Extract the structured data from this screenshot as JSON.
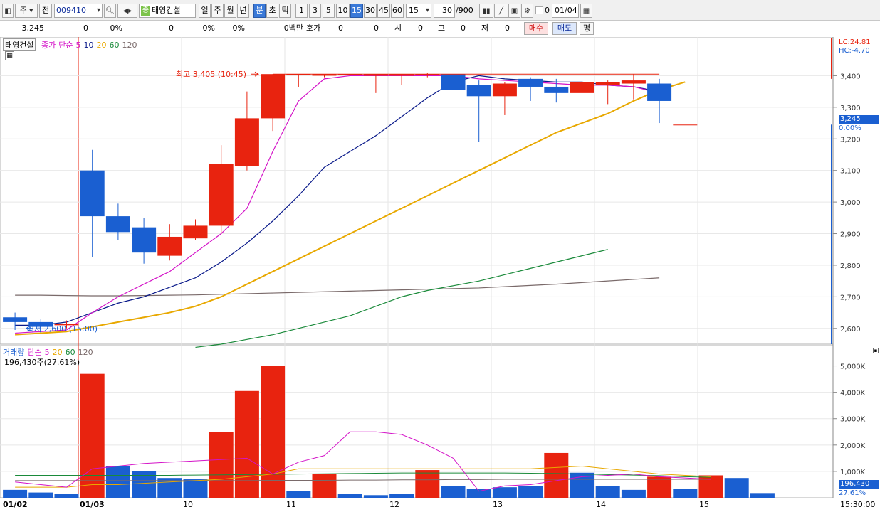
{
  "toolbar": {
    "period_daily": "주",
    "prev": "전",
    "code": "009410",
    "stock_name": "태영건설",
    "stock_badge": "종",
    "periods": [
      "일",
      "주",
      "월",
      "년",
      "분",
      "초",
      "틱"
    ],
    "selected_period": "분",
    "intervals": [
      "1",
      "3",
      "5",
      "10",
      "15",
      "30",
      "45",
      "60"
    ],
    "selected_interval": "15",
    "interval_value": "15",
    "count": "30",
    "count_total": "/900",
    "checkbox_value": "0",
    "date": "01/04"
  },
  "info": {
    "price": "3,245",
    "change": "0",
    "change_pct": "0%",
    "volume": "0",
    "volume_pct": "0%",
    "val_pct": "0%",
    "amount": "0백만",
    "hoga_label": "호가",
    "hoga_value": "0",
    "hoga_value2": "0",
    "open_label": "시",
    "open_value": "0",
    "high_label": "고",
    "high_value": "0",
    "low_label": "저",
    "low_value": "0",
    "buy_button": "매수",
    "sell_button": "매도",
    "eval_button": "평"
  },
  "colors": {
    "up": "#e8230f",
    "down": "#1a5fd1",
    "ma5": "#d414c8",
    "ma10": "#0a1a8a",
    "ma20": "#e8a800",
    "ma60": "#1a8a3a",
    "ma120": "#7a6a6a"
  },
  "chart_data": [
    {
      "type": "candlestick",
      "title": "태영건설",
      "legend": [
        "종가",
        "단순",
        "5",
        "10",
        "20",
        "60",
        "120"
      ],
      "ylim": [
        2550,
        3500
      ],
      "yticks": [
        2600,
        2700,
        2800,
        2900,
        3000,
        3100,
        3200,
        3300,
        3400
      ],
      "ytick_labels": [
        "2,600",
        "2,700",
        "2,800",
        "2,900",
        "3,000",
        "3,100",
        "3,200",
        "3,300",
        "3,400"
      ],
      "candles": [
        {
          "o": 2635,
          "h": 2650,
          "l": 2595,
          "c": 2620
        },
        {
          "o": 2620,
          "h": 2630,
          "l": 2600,
          "c": 2605
        },
        {
          "o": 2610,
          "h": 2625,
          "l": 2600,
          "c": 2615
        },
        {
          "o": 3100,
          "h": 3165,
          "l": 2825,
          "c": 2955
        },
        {
          "o": 2955,
          "h": 2995,
          "l": 2880,
          "c": 2905
        },
        {
          "o": 2920,
          "h": 2950,
          "l": 2805,
          "c": 2840
        },
        {
          "o": 2830,
          "h": 2930,
          "l": 2815,
          "c": 2890
        },
        {
          "o": 2885,
          "h": 2945,
          "l": 2880,
          "c": 2925
        },
        {
          "o": 2925,
          "h": 3180,
          "l": 2900,
          "c": 3120
        },
        {
          "o": 3115,
          "h": 3350,
          "l": 3100,
          "c": 3265
        },
        {
          "o": 3265,
          "h": 3405,
          "l": 3225,
          "c": 3405
        },
        {
          "o": 3405,
          "h": 3405,
          "l": 3365,
          "c": 3405
        },
        {
          "o": 3400,
          "h": 3405,
          "l": 3395,
          "c": 3405
        },
        {
          "o": 3405,
          "h": 3405,
          "l": 3400,
          "c": 3405
        },
        {
          "o": 3400,
          "h": 3405,
          "l": 3345,
          "c": 3405
        },
        {
          "o": 3400,
          "h": 3405,
          "l": 3370,
          "c": 3405
        },
        {
          "o": 3405,
          "h": 3410,
          "l": 3395,
          "c": 3405
        },
        {
          "o": 3405,
          "h": 3405,
          "l": 3380,
          "c": 3355
        },
        {
          "o": 3370,
          "h": 3385,
          "l": 3190,
          "c": 3335
        },
        {
          "o": 3335,
          "h": 3380,
          "l": 3275,
          "c": 3375
        },
        {
          "o": 3390,
          "h": 3395,
          "l": 3320,
          "c": 3365
        },
        {
          "o": 3365,
          "h": 3390,
          "l": 3315,
          "c": 3345
        },
        {
          "o": 3345,
          "h": 3385,
          "l": 3255,
          "c": 3380
        },
        {
          "o": 3370,
          "h": 3385,
          "l": 3310,
          "c": 3380
        },
        {
          "o": 3375,
          "h": 3405,
          "l": 3325,
          "c": 3385
        },
        {
          "o": 3375,
          "h": 3390,
          "l": 3250,
          "c": 3320
        },
        {
          "o": 3245,
          "h": 3245,
          "l": 3245,
          "c": 3245
        }
      ],
      "ma5": [
        2585,
        2590,
        2595,
        2650,
        2700,
        2740,
        2780,
        2840,
        2900,
        2980,
        3160,
        3320,
        3390,
        3400,
        3400,
        3400,
        3400,
        3400,
        3390,
        3385,
        3380,
        3375,
        3370,
        3370,
        3365,
        3345
      ],
      "ma10": [
        2610,
        2610,
        2620,
        2650,
        2680,
        2700,
        2730,
        2760,
        2810,
        2870,
        2940,
        3020,
        3110,
        3160,
        3210,
        3270,
        3330,
        3380,
        3400,
        3390,
        3385,
        3380,
        3380,
        3370,
        3365,
        3350
      ],
      "ma20": [
        2580,
        2585,
        2590,
        2605,
        2620,
        2635,
        2650,
        2670,
        2700,
        2740,
        2780,
        2820,
        2860,
        2900,
        2940,
        2980,
        3020,
        3060,
        3100,
        3140,
        3180,
        3220,
        3250,
        3280,
        3320,
        3355,
        3380
      ],
      "ma60": [
        null,
        null,
        null,
        null,
        null,
        null,
        null,
        2540,
        2550,
        2565,
        2580,
        2600,
        2620,
        2640,
        2670,
        2700,
        2720,
        2735,
        2750,
        2770,
        2790,
        2810,
        2830,
        2850
      ],
      "ma120": [
        2705,
        2705,
        2704,
        2703,
        2703,
        2704,
        2705,
        2706,
        2708,
        2710,
        2712,
        2714,
        2716,
        2718,
        2720,
        2722,
        2724,
        2726,
        2728,
        2732,
        2736,
        2740,
        2745,
        2750,
        2755,
        2760
      ],
      "high_annotation": "최고 3,405 (10:45)",
      "low_annotation": "최저 2,600 (15:00)",
      "current_price": "3,245",
      "current_pct": "0.00%",
      "lc_label": "LC:24.81",
      "hc_label": "HC:-4.70"
    },
    {
      "type": "bar",
      "title": "거래량",
      "legend": [
        "거래량",
        "단순",
        "5",
        "20",
        "60",
        "120"
      ],
      "current_label": "196,430주(27.61%)",
      "ylim": [
        0,
        5500
      ],
      "yticks": [
        1000,
        2000,
        3000,
        4000,
        5000
      ],
      "ytick_labels": [
        "1,000K",
        "2,000K",
        "3,000K",
        "4,000K",
        "5,000K"
      ],
      "values": [
        300,
        200,
        150,
        4700,
        1200,
        1000,
        750,
        700,
        2500,
        4050,
        5000,
        250,
        900,
        150,
        100,
        150,
        1050,
        450,
        350,
        400,
        450,
        1700,
        950,
        450,
        300,
        800,
        350,
        850,
        750,
        180
      ],
      "up": [
        false,
        false,
        false,
        true,
        false,
        false,
        false,
        false,
        true,
        true,
        true,
        false,
        true,
        false,
        false,
        false,
        true,
        false,
        false,
        false,
        false,
        true,
        false,
        false,
        false,
        true,
        false,
        true,
        false,
        false
      ],
      "ma5": [
        600,
        500,
        400,
        1100,
        1200,
        1300,
        1350,
        1400,
        1450,
        1500,
        900,
        1350,
        1600,
        2500,
        2500,
        2400,
        2000,
        1500,
        250,
        450,
        500,
        650,
        800,
        850,
        900,
        800,
        750,
        700
      ],
      "ma20": [
        400,
        400,
        400,
        500,
        500,
        550,
        600,
        650,
        700,
        800,
        900,
        1100,
        1100,
        1100,
        1100,
        1100,
        1100,
        1100,
        1100,
        1100,
        1100,
        1150,
        1200,
        1100,
        1000,
        900,
        850,
        800
      ],
      "ma60": [
        850,
        850,
        850,
        850,
        850,
        850,
        850,
        860,
        870,
        880,
        890,
        900,
        910,
        920,
        930,
        940,
        940,
        940,
        940,
        940,
        930,
        920,
        900,
        880,
        860,
        840,
        800,
        780
      ],
      "ma120": [
        650,
        650,
        650,
        650,
        650,
        650,
        650,
        650,
        650,
        650,
        660,
        660,
        660,
        670,
        670,
        680,
        680,
        690,
        690,
        700,
        700,
        700,
        700,
        700,
        700,
        700,
        700,
        700
      ],
      "current_value": "196,430",
      "current_pct": "27.61%"
    }
  ],
  "x_labels": [
    "01/02",
    "01/03",
    "10",
    "11",
    "12",
    "13",
    "14",
    "15",
    "15:30:00"
  ]
}
